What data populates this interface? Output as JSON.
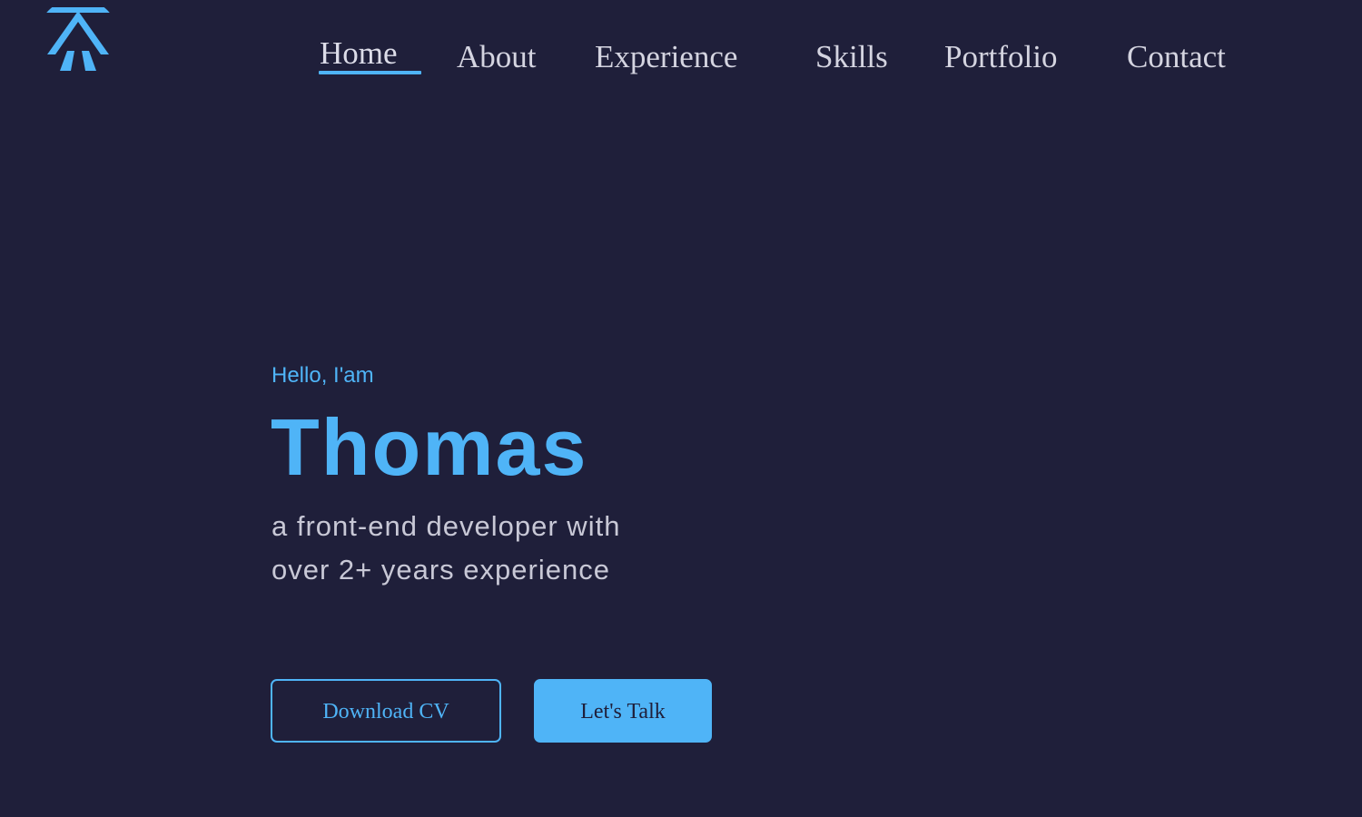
{
  "colors": {
    "background": "#1f1f3a",
    "accent": "#4fb4f7",
    "nav_text": "#d4d4e0",
    "body_text": "#c8c8d6"
  },
  "header": {
    "logo_icon": "logo-icon",
    "nav": [
      {
        "label": "Home",
        "active": true
      },
      {
        "label": "About",
        "active": false
      },
      {
        "label": "Experience",
        "active": false
      },
      {
        "label": "Skills",
        "active": false
      },
      {
        "label": "Portfolio",
        "active": false
      },
      {
        "label": "Contact",
        "active": false
      }
    ]
  },
  "hero": {
    "greeting": "Hello, I'am",
    "name": "Thomas",
    "tagline_line1": "a front-end developer with",
    "tagline_line2": "over 2+ years experience",
    "download_label": "Download CV",
    "talk_label": "Let's Talk"
  }
}
